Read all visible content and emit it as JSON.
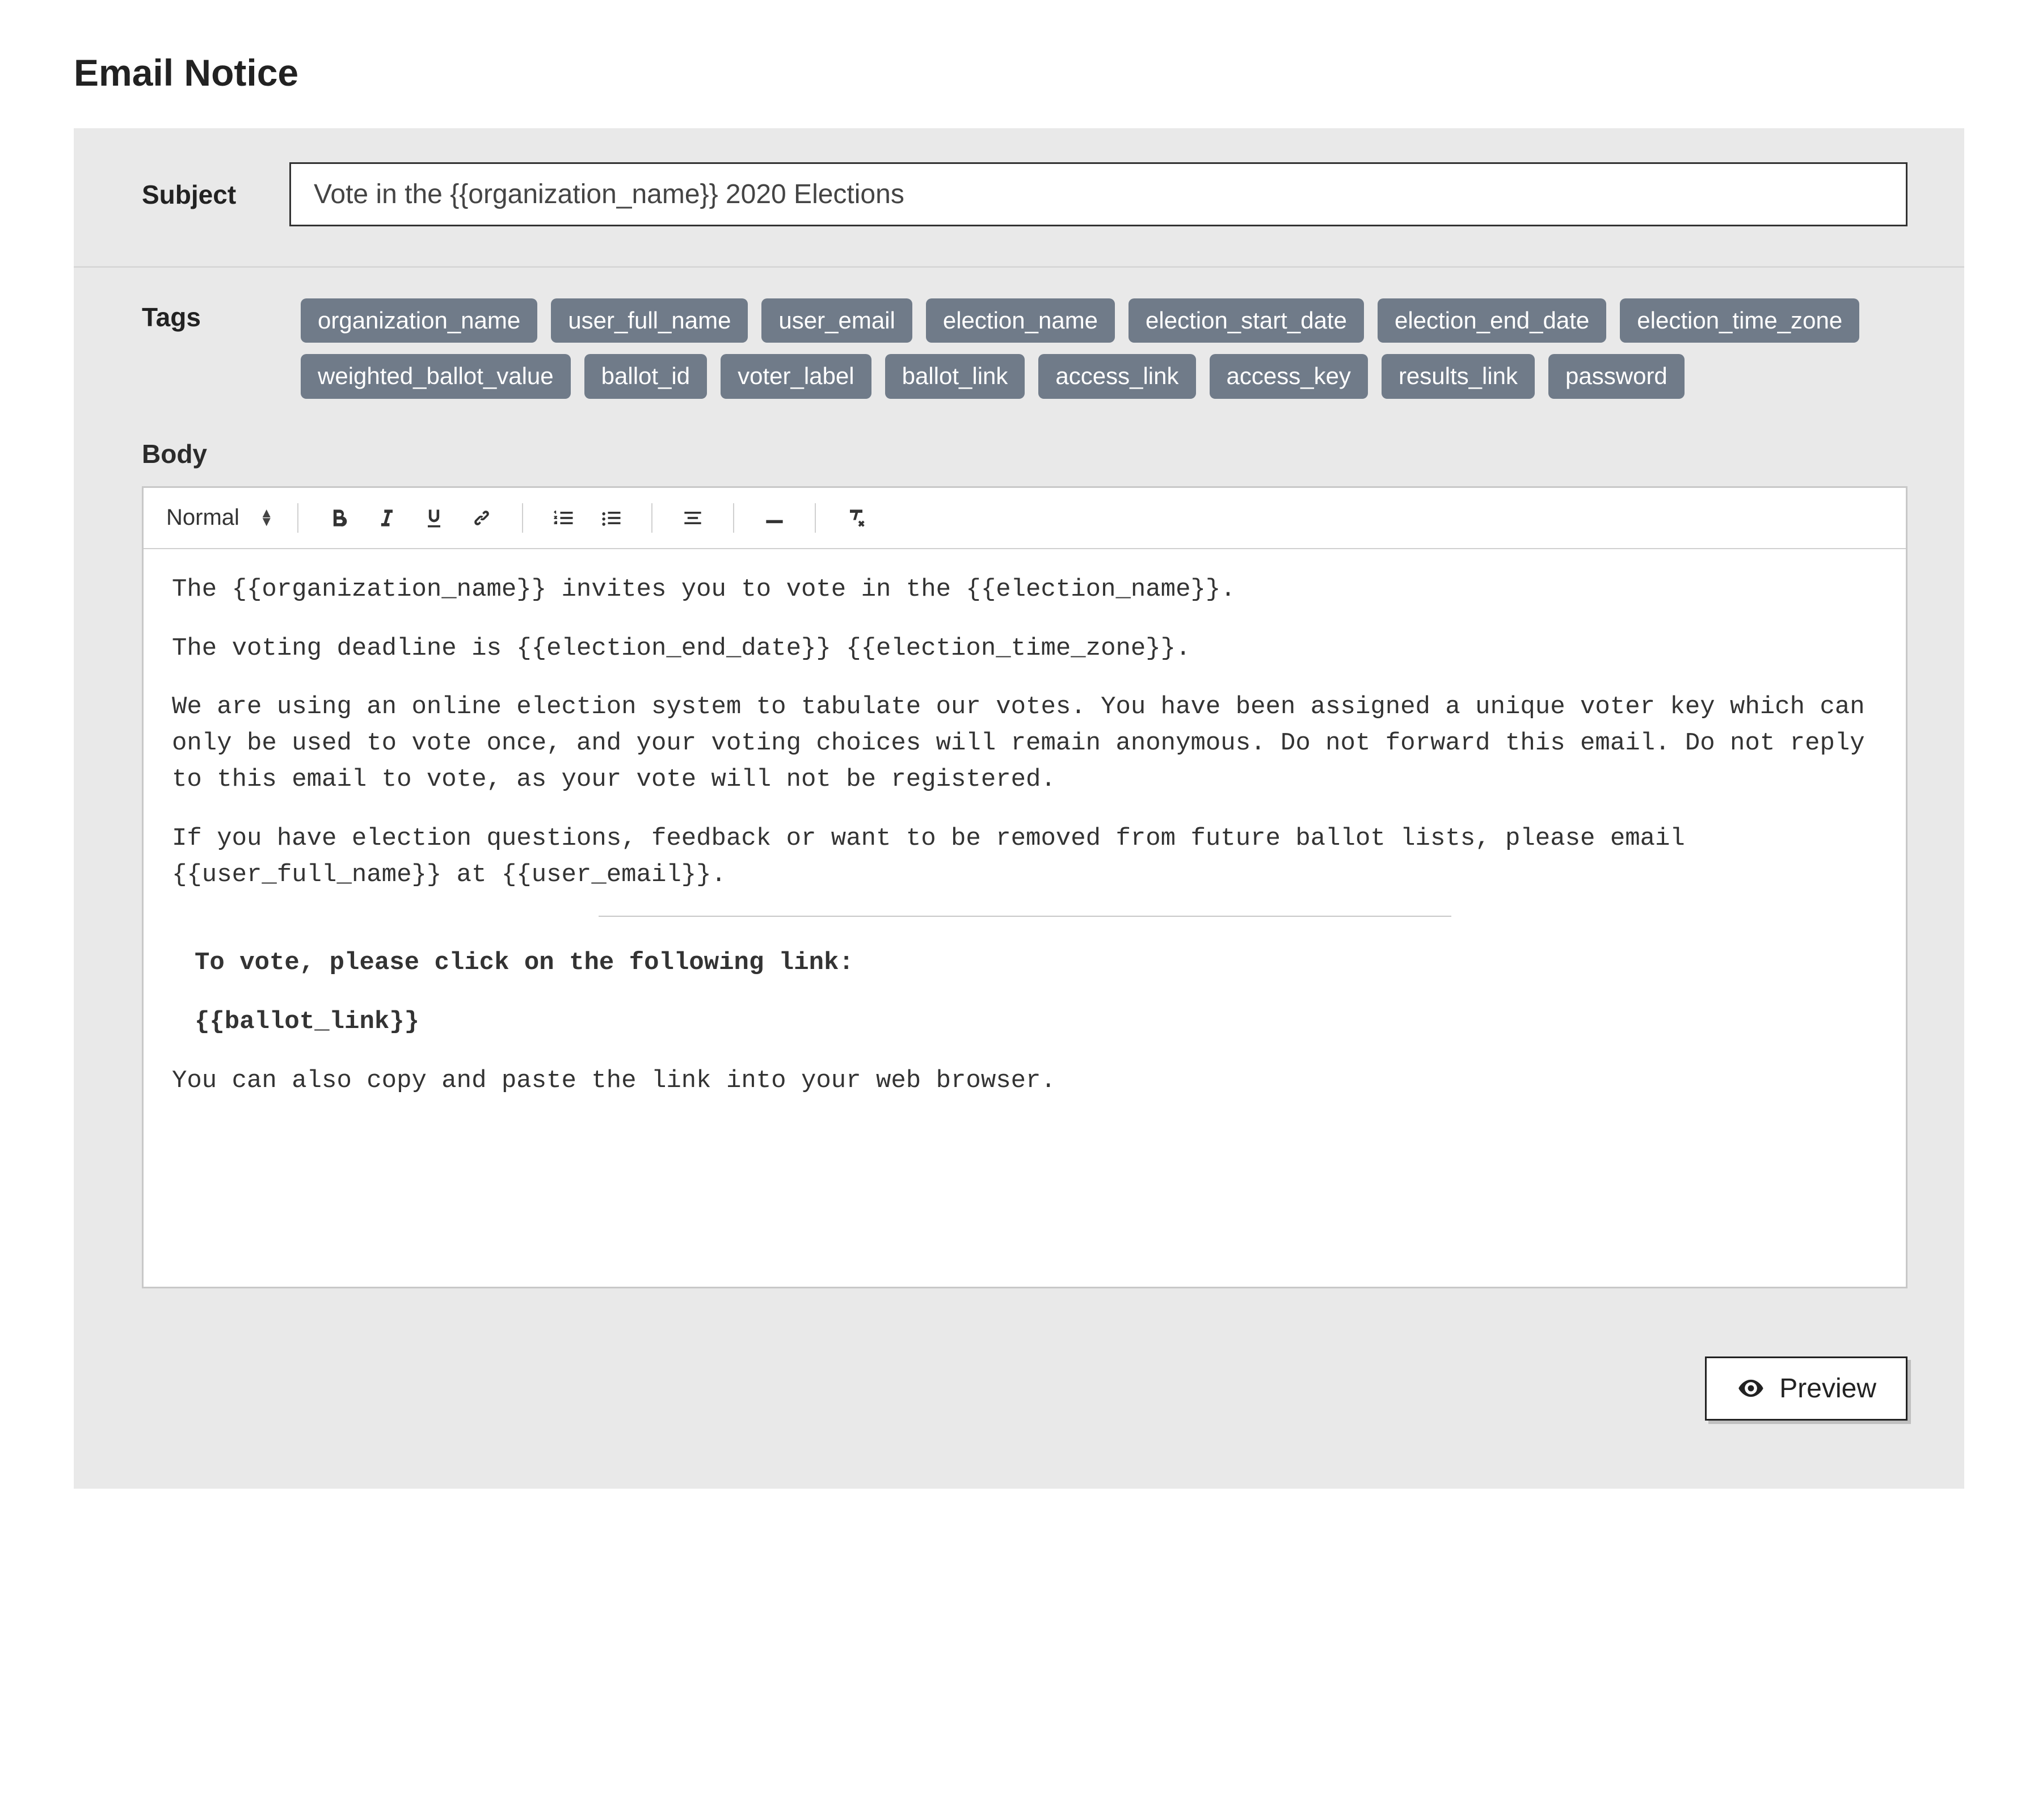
{
  "page_title": "Email Notice",
  "subject": {
    "label": "Subject",
    "value": "Vote in the {{organization_name}} 2020 Elections"
  },
  "tags": {
    "label": "Tags",
    "items": [
      "organization_name",
      "user_full_name",
      "user_email",
      "election_name",
      "election_start_date",
      "election_end_date",
      "election_time_zone",
      "weighted_ballot_value",
      "ballot_id",
      "voter_label",
      "ballot_link",
      "access_link",
      "access_key",
      "results_link",
      "password"
    ]
  },
  "body": {
    "label": "Body",
    "toolbar": {
      "format_label": "Normal",
      "icons": {
        "bold": "bold-icon",
        "italic": "italic-icon",
        "underline": "underline-icon",
        "link": "link-icon",
        "ol": "ordered-list-icon",
        "ul": "unordered-list-icon",
        "align": "align-icon",
        "hr": "horizontal-rule-icon",
        "clear": "clear-formatting-icon"
      }
    },
    "paragraphs": {
      "p1": "The {{organization_name}} invites you to vote in the {{election_name}}.",
      "p2": "The voting deadline is {{election_end_date}} {{election_time_zone}}.",
      "p3": "We are using an online election system to tabulate our votes. You have been assigned a unique voter key which can only be used to vote once, and your voting choices will remain anonymous. Do not forward this email. Do not reply to this email to vote, as your vote will not be registered.",
      "p4": "If you have election questions, feedback or want to be removed from future ballot lists, please email {{user_full_name}} at {{user_email}}.",
      "p5": "To vote, please click on the following link:",
      "p6": "{{ballot_link}}",
      "p7": "You can also copy and paste the link into your web browser."
    }
  },
  "preview_button": "Preview"
}
